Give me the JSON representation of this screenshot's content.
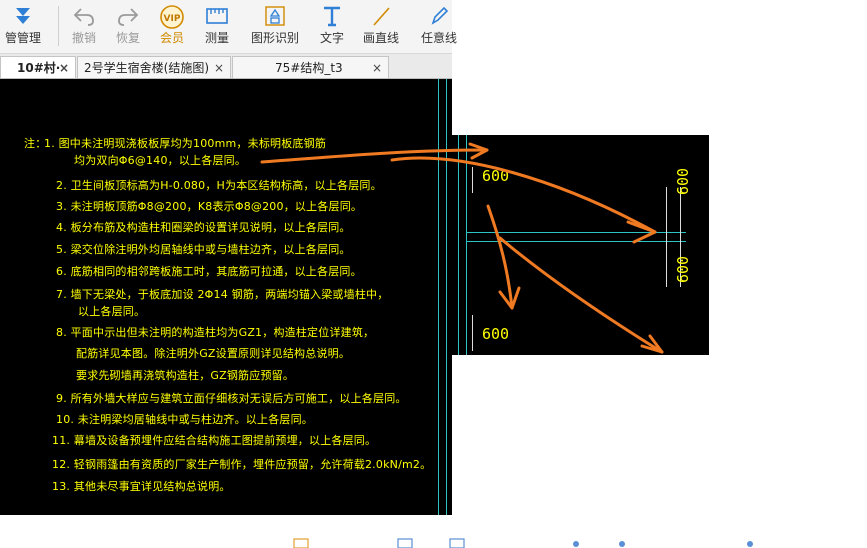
{
  "toolbar": {
    "tools": [
      {
        "name": "manage",
        "label": "管管理",
        "icon": "manage-icon",
        "enabled": true
      },
      {
        "name": "undo",
        "label": "撤销",
        "icon": "undo-icon",
        "enabled": false
      },
      {
        "name": "redo",
        "label": "恢复",
        "icon": "redo-icon",
        "enabled": false
      },
      {
        "name": "vip",
        "label": "会员",
        "icon": "vip-icon",
        "enabled": true
      },
      {
        "name": "measure",
        "label": "测量",
        "icon": "ruler-icon",
        "enabled": true
      },
      {
        "name": "shape-recognition",
        "label": "图形识别",
        "icon": "shape-recognition-icon",
        "enabled": true
      },
      {
        "name": "text",
        "label": "文字",
        "icon": "text-icon",
        "enabled": true
      },
      {
        "name": "line",
        "label": "画直线",
        "icon": "line-icon",
        "enabled": true
      },
      {
        "name": "freehand",
        "label": "任意线",
        "icon": "pen-icon",
        "enabled": true
      }
    ],
    "vip_badge": "VIP"
  },
  "tabs": [
    {
      "label": "10#村·",
      "active": true
    },
    {
      "label": "2号学生宿舍楼(结施图)",
      "active": false
    },
    {
      "label": "75#结构_t3",
      "active": false
    }
  ],
  "tab_close": "×",
  "notes": {
    "title": "注：",
    "lines": [
      "1. 图中未注明现浇板板厚均为100mm，未标明板底钢筋",
      "均为双向Φ6@140，以上各层同。",
      "2. 卫生间板顶标高为H-0.080，H为本区结构标高，以上各层同。",
      "3. 未注明板顶筋Φ8@200，K8表示Φ8@200，以上各层同。",
      "4. 板分布筋及构造柱和圈梁的设置详见说明，以上各层同。",
      "5. 梁交位除注明外均居轴线中或与墙柱边齐，以上各层同。",
      "6. 底筋相同的相邻跨板施工时，其底筋可拉通，以上各层同。",
      "7. 墙下无梁处，于板底加设 2Φ14 钢筋，两端均锚入梁或墙柱中，",
      "以上各层同。",
      "8. 平面中示出但未注明的构造柱均为GZ1，构造柱定位详建筑，",
      "配筋详见本图。除注明外GZ设置原则详见结构总说明。",
      "要求先砌墙再浇筑构造柱，GZ钢筋应预留。",
      "9. 所有外墙大样应与建筑立面仔细核对无误后方可施工，以上各层同。",
      "10. 未注明梁均居轴线中或与柱边齐。以上各层同。",
      "11. 幕墙及设备预埋件应结合结构施工图提前预埋，以上各层同。",
      "12. 轻钢雨篷由有资质的厂家生产制作，埋件应预留，允许荷载2.0kN/m2。",
      "13. 其他未尽事宜详见结构总说明。"
    ]
  },
  "detail": {
    "dims": [
      "600",
      "600",
      "600",
      "600"
    ]
  },
  "colors": {
    "cad_text": "#ffff00",
    "cad_line": "#2ec4c4",
    "annotation": "#f07a22",
    "canvas_bg": "#000000"
  }
}
